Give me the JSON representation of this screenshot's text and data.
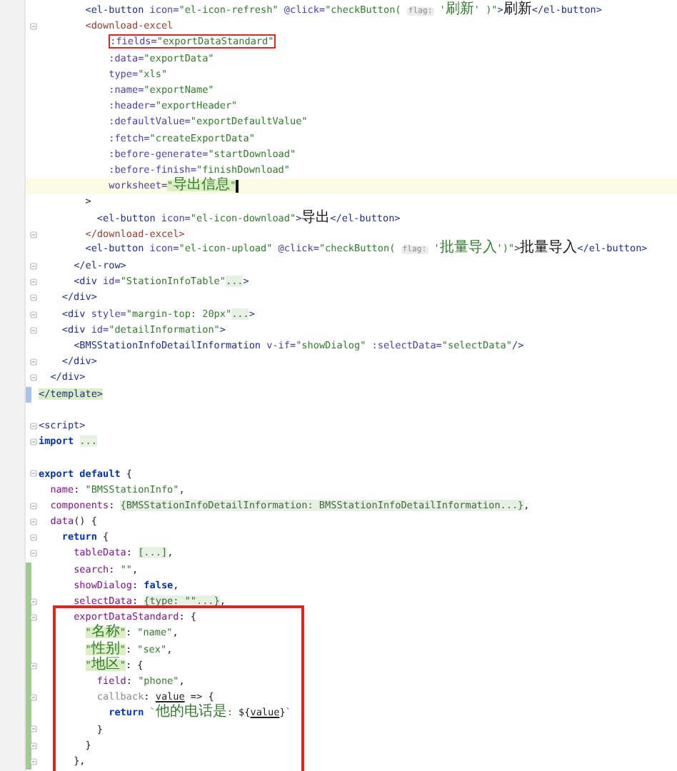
{
  "lines": [
    {
      "tokens": [
        {
          "kind": "tag",
          "text": "        <el-button"
        },
        {
          "kind": "attr",
          "text": " icon="
        },
        {
          "kind": "string",
          "text": "\"el-icon-refresh\""
        },
        {
          "kind": "attr",
          "text": " @click="
        },
        {
          "kind": "string",
          "text": "\"checkButton( "
        },
        {
          "kind": "hint",
          "text": "flag:"
        },
        {
          "kind": "string",
          "text": " '刷新' )\""
        },
        {
          "kind": "tag",
          "text": ">"
        },
        {
          "kind": "text",
          "text": "刷新"
        },
        {
          "kind": "tag",
          "text": "</el-button>"
        }
      ]
    },
    {
      "fold": true,
      "tokens": [
        {
          "kind": "component",
          "text": "        <download-excel"
        }
      ]
    },
    {
      "tokens": [
        {
          "kind": "attr",
          "text": "            :fields=",
          "boxed": true
        },
        {
          "kind": "string",
          "text": "\"exportDataStandard\"",
          "boxed": true
        }
      ]
    },
    {
      "tokens": [
        {
          "kind": "attr",
          "text": "            :data="
        },
        {
          "kind": "string",
          "text": "\"exportData\""
        }
      ]
    },
    {
      "tokens": [
        {
          "kind": "attr",
          "text": "            type="
        },
        {
          "kind": "string",
          "text": "\"xls\""
        }
      ]
    },
    {
      "tokens": [
        {
          "kind": "attr",
          "text": "            :name="
        },
        {
          "kind": "string",
          "text": "\"exportName\""
        }
      ]
    },
    {
      "tokens": [
        {
          "kind": "attr",
          "text": "            :header="
        },
        {
          "kind": "string",
          "text": "\"exportHeader\""
        }
      ]
    },
    {
      "tokens": [
        {
          "kind": "attr",
          "text": "            :defaultValue="
        },
        {
          "kind": "string",
          "text": "\"exportDefaultValue\""
        }
      ]
    },
    {
      "tokens": [
        {
          "kind": "attr",
          "text": "            :fetch="
        },
        {
          "kind": "string",
          "text": "\"createExportData\""
        }
      ]
    },
    {
      "tokens": [
        {
          "kind": "attr",
          "text": "            :before-generate="
        },
        {
          "kind": "string",
          "text": "\"startDownload\""
        }
      ]
    },
    {
      "tokens": [
        {
          "kind": "attr",
          "text": "            :before-finish="
        },
        {
          "kind": "string",
          "text": "\"finishDownload\""
        }
      ]
    },
    {
      "current": true,
      "tokens": [
        {
          "kind": "attr",
          "text": "            worksheet="
        },
        {
          "kind": "string",
          "text": "\"导出信息\"",
          "highlighted": true
        }
      ]
    },
    {
      "tokens": [
        {
          "kind": "punct",
          "text": "        >"
        }
      ]
    },
    {
      "tokens": [
        {
          "kind": "tag",
          "text": "          <el-button"
        },
        {
          "kind": "attr",
          "text": " icon="
        },
        {
          "kind": "string",
          "text": "\"el-icon-download\""
        },
        {
          "kind": "tag",
          "text": ">"
        },
        {
          "kind": "text",
          "text": "导出"
        },
        {
          "kind": "tag",
          "text": "</el-button>"
        }
      ]
    },
    {
      "fold": true,
      "tokens": [
        {
          "kind": "component",
          "text": "        </download-excel>"
        }
      ]
    },
    {
      "tokens": [
        {
          "kind": "tag",
          "text": "        <el-button"
        },
        {
          "kind": "attr",
          "text": " icon="
        },
        {
          "kind": "string",
          "text": "\"el-icon-upload\""
        },
        {
          "kind": "attr",
          "text": " @click="
        },
        {
          "kind": "string",
          "text": "\"checkButton( "
        },
        {
          "kind": "hint",
          "text": "flag:"
        },
        {
          "kind": "string",
          "text": " '批量导入')\""
        },
        {
          "kind": "tag",
          "text": ">"
        },
        {
          "kind": "text",
          "text": "批量导入"
        },
        {
          "kind": "tag",
          "text": "</el-button>"
        }
      ]
    },
    {
      "fold": true,
      "tokens": [
        {
          "kind": "tag",
          "text": "      </el-row>"
        }
      ]
    },
    {
      "fold": true,
      "tokens": [
        {
          "kind": "tag",
          "text": "      <div"
        },
        {
          "kind": "attr",
          "text": " id="
        },
        {
          "kind": "string",
          "text": "\"StationInfoTable\""
        },
        {
          "kind": "fold",
          "text": "..."
        },
        {
          "kind": "tag",
          "text": ">"
        }
      ]
    },
    {
      "fold": true,
      "tokens": [
        {
          "kind": "tag",
          "text": "    </div>"
        }
      ]
    },
    {
      "fold": true,
      "tokens": [
        {
          "kind": "tag",
          "text": "    <div"
        },
        {
          "kind": "attr",
          "text": " style="
        },
        {
          "kind": "string",
          "text": "\"margin-top: 20px\""
        },
        {
          "kind": "fold",
          "text": "..."
        },
        {
          "kind": "tag",
          "text": ">"
        }
      ]
    },
    {
      "fold": true,
      "tokens": [
        {
          "kind": "tag",
          "text": "    <div"
        },
        {
          "kind": "attr",
          "text": " id="
        },
        {
          "kind": "string",
          "text": "\"detailInformation\""
        },
        {
          "kind": "tag",
          "text": ">"
        }
      ]
    },
    {
      "tokens": [
        {
          "kind": "tag",
          "text": "      <BMSStationInfoDetailInformation"
        },
        {
          "kind": "attr",
          "text": " v-if="
        },
        {
          "kind": "string",
          "text": "\"showDialog\""
        },
        {
          "kind": "attr",
          "text": " :selectData="
        },
        {
          "kind": "string",
          "text": "\"selectData\""
        },
        {
          "kind": "tag",
          "text": "/>"
        }
      ]
    },
    {
      "fold": true,
      "tokens": [
        {
          "kind": "tag",
          "text": "    </div>"
        }
      ]
    },
    {
      "fold": true,
      "tokens": [
        {
          "kind": "tag",
          "text": "  </div>"
        }
      ]
    },
    {
      "color": "#a9c2e8",
      "tokens": [
        {
          "kind": "tag",
          "text": "</template>",
          "highlighted": true
        }
      ]
    },
    {
      "kind": "blank"
    },
    {
      "fold": true,
      "tokens": [
        {
          "kind": "tag",
          "text": "<script>"
        }
      ]
    },
    {
      "fold": true,
      "tokens": [
        {
          "kind": "keyword",
          "text": "import "
        },
        {
          "kind": "fold",
          "text": "..."
        }
      ]
    },
    {
      "kind": "blank"
    },
    {
      "fold": true,
      "tokens": [
        {
          "kind": "keyword",
          "text": "export default"
        },
        {
          "kind": "punct",
          "text": " {"
        }
      ]
    },
    {
      "tokens": [
        {
          "kind": "prop",
          "text": "  name"
        },
        {
          "kind": "punct",
          "text": ": "
        },
        {
          "kind": "string",
          "text": "\"BMSStationInfo\""
        },
        {
          "kind": "punct",
          "text": ","
        }
      ]
    },
    {
      "fold": true,
      "tokens": [
        {
          "kind": "prop",
          "text": "  components"
        },
        {
          "kind": "punct",
          "text": ": "
        },
        {
          "kind": "fold",
          "text": "{BMSStationInfoDetailInformation: BMSStationInfoDetailInformation...}"
        },
        {
          "kind": "punct",
          "text": ","
        }
      ]
    },
    {
      "fold": true,
      "tokens": [
        {
          "kind": "prop",
          "text": "  data"
        },
        {
          "kind": "punct",
          "text": "() {"
        }
      ]
    },
    {
      "fold": true,
      "tokens": [
        {
          "kind": "keyword",
          "text": "    return"
        },
        {
          "kind": "punct",
          "text": " {"
        }
      ]
    },
    {
      "fold": true,
      "tokens": [
        {
          "kind": "prop",
          "text": "      tableData"
        },
        {
          "kind": "punct",
          "text": ": "
        },
        {
          "kind": "fold",
          "text": "[...]"
        },
        {
          "kind": "punct",
          "text": ","
        }
      ]
    },
    {
      "color": "#9fcb93",
      "tokens": [
        {
          "kind": "prop",
          "text": "      search"
        },
        {
          "kind": "punct",
          "text": ": "
        },
        {
          "kind": "string",
          "text": "\"\""
        },
        {
          "kind": "punct",
          "text": ","
        }
      ]
    },
    {
      "color": "#9fcb93",
      "tokens": [
        {
          "kind": "prop",
          "text": "      showDialog"
        },
        {
          "kind": "punct",
          "text": ": "
        },
        {
          "kind": "keyword",
          "text": "false"
        },
        {
          "kind": "punct",
          "text": ","
        }
      ]
    },
    {
      "color": "#9fcb93",
      "fold": true,
      "tokens": [
        {
          "kind": "prop",
          "text": "      selectData"
        },
        {
          "kind": "punct",
          "text": ": "
        },
        {
          "kind": "fold",
          "text": "{type: \"\"...}"
        },
        {
          "kind": "punct",
          "text": ","
        }
      ]
    },
    {
      "kind": "group",
      "boxed": true,
      "lines": [
        {
          "color": "#9fcb93",
          "fold": true,
          "tokens": [
            {
              "kind": "prop",
              "text": "      exportDataStandard"
            },
            {
              "kind": "punct",
              "text": ": {"
            }
          ]
        },
        {
          "color": "#9fcb93",
          "tokens": [
            {
              "kind": "string",
              "text": "        \"名称\"",
              "highlighted": true
            },
            {
              "kind": "punct",
              "text": ": "
            },
            {
              "kind": "string",
              "text": "\"name\""
            },
            {
              "kind": "punct",
              "text": ","
            }
          ]
        },
        {
          "color": "#9fcb93",
          "tokens": [
            {
              "kind": "string",
              "text": "        \"性别\"",
              "highlighted": true
            },
            {
              "kind": "punct",
              "text": ": "
            },
            {
              "kind": "string",
              "text": "\"sex\""
            },
            {
              "kind": "punct",
              "text": ","
            }
          ]
        },
        {
          "color": "#9fcb93",
          "fold": true,
          "tokens": [
            {
              "kind": "string",
              "text": "        \"地区\"",
              "highlighted": true
            },
            {
              "kind": "punct",
              "text": ": {"
            }
          ]
        },
        {
          "color": "#9fcb93",
          "tokens": [
            {
              "kind": "prop",
              "text": "          field"
            },
            {
              "kind": "punct",
              "text": ": "
            },
            {
              "kind": "string",
              "text": "\"phone\""
            },
            {
              "kind": "punct",
              "text": ","
            }
          ]
        },
        {
          "color": "#9fcb93",
          "fold": true,
          "tokens": [
            {
              "kind": "muted",
              "text": "          callback"
            },
            {
              "kind": "punct",
              "text": ": "
            },
            {
              "kind": "param",
              "text": "value"
            },
            {
              "kind": "punct",
              "text": " => {"
            }
          ]
        },
        {
          "color": "#9fcb93",
          "tokens": [
            {
              "kind": "keyword",
              "text": "            return "
            },
            {
              "kind": "string",
              "text": "`他的电话是: "
            },
            {
              "kind": "punct",
              "text": "${"
            },
            {
              "kind": "param",
              "text": "value"
            },
            {
              "kind": "punct",
              "text": "}"
            },
            {
              "kind": "string",
              "text": "`"
            }
          ]
        },
        {
          "color": "#9fcb93",
          "fold": true,
          "tokens": [
            {
              "kind": "punct",
              "text": "          }"
            }
          ]
        },
        {
          "color": "#9fcb93",
          "fold": true,
          "tokens": [
            {
              "kind": "punct",
              "text": "        }"
            }
          ]
        },
        {
          "color": "#9fcb93",
          "fold": true,
          "tokens": [
            {
              "kind": "punct",
              "text": "      },"
            }
          ]
        }
      ]
    }
  ]
}
